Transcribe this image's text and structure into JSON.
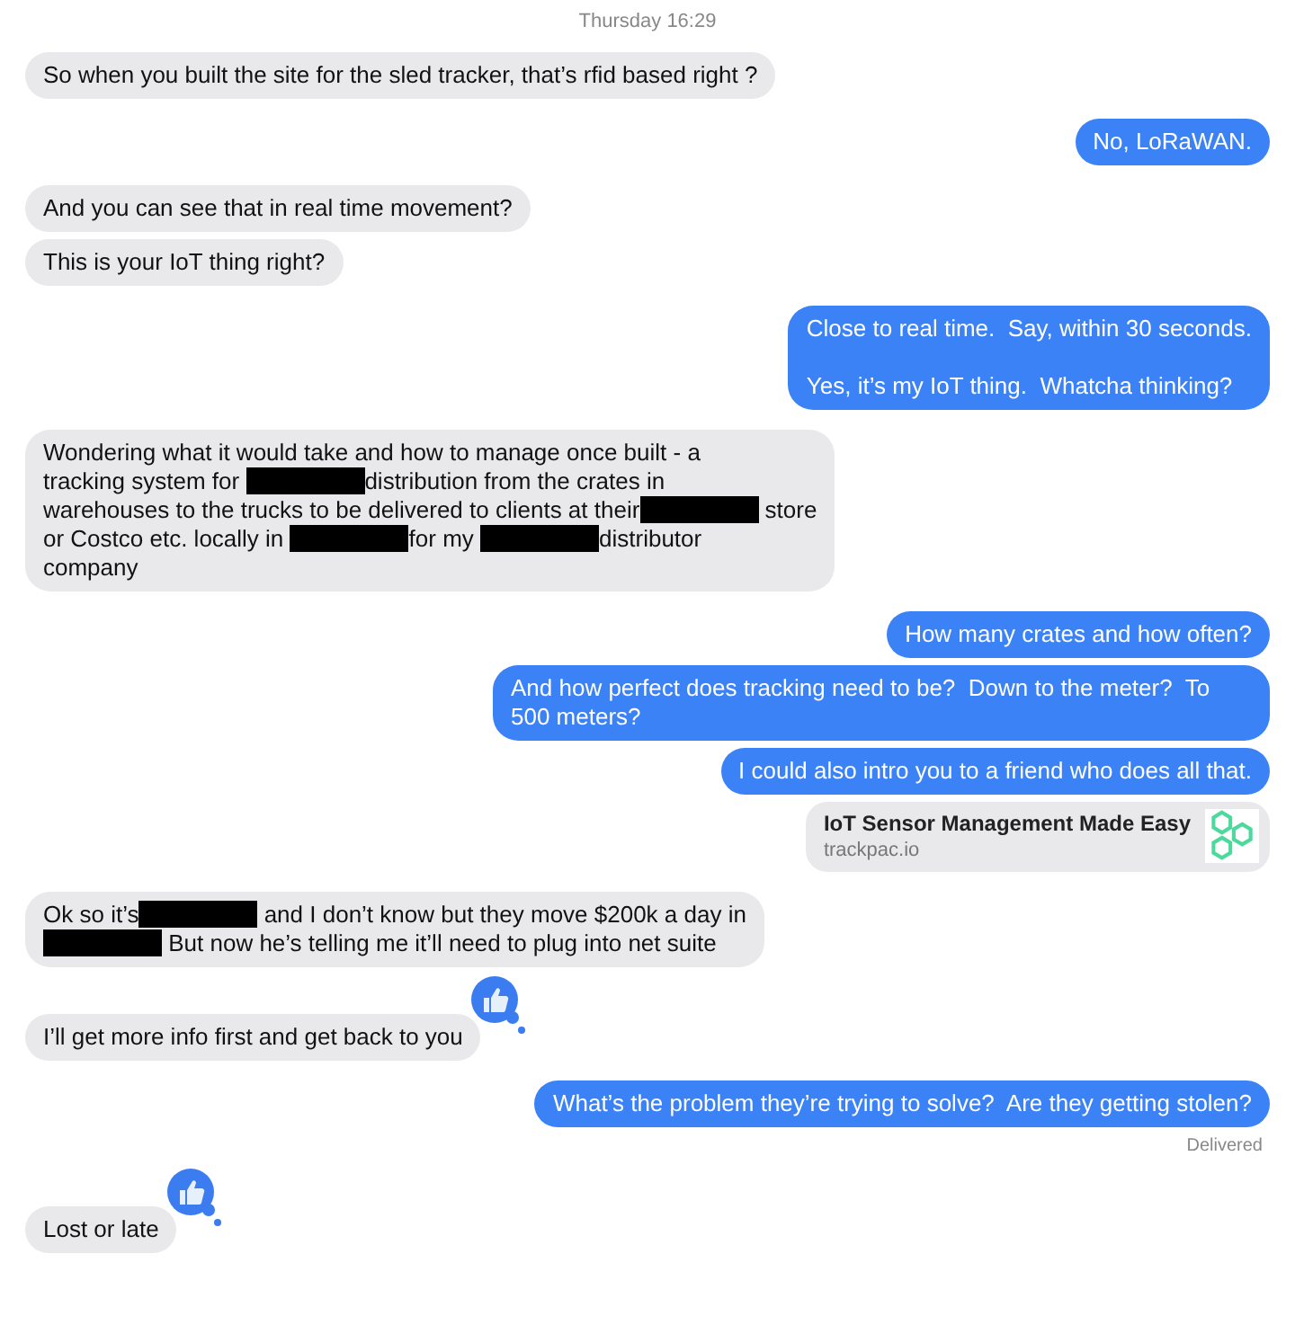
{
  "timestamp": "Thursday 16:29",
  "messages": [
    {
      "kind": "received",
      "text": "So when you built the site for the sled tracker, that’s rfid based right ?"
    },
    {
      "kind": "sent",
      "text": "No, LoRaWAN."
    },
    {
      "kind": "received",
      "text": "And you can see that in real time movement?"
    },
    {
      "kind": "received",
      "text": "This is your IoT thing right?"
    },
    {
      "kind": "sent",
      "text": "Close to real time.  Say, within 30 seconds.\n\nYes, it’s my IoT thing.  Whatcha thinking?"
    },
    {
      "kind": "received",
      "lines": [
        [
          {
            "kind": "text",
            "text": "Wondering what it would take and how to manage once built - a"
          }
        ],
        [
          {
            "kind": "text",
            "text": "tracking system for "
          },
          {
            "kind": "redacted"
          },
          {
            "kind": "text",
            "text": "distribution from the crates in"
          }
        ],
        [
          {
            "kind": "text",
            "text": "warehouses to the trucks to be delivered to clients at their"
          },
          {
            "kind": "redacted"
          },
          {
            "kind": "text",
            "text": " store"
          }
        ],
        [
          {
            "kind": "text",
            "text": "or Costco etc. locally in "
          },
          {
            "kind": "redacted"
          },
          {
            "kind": "text",
            "text": "for my "
          },
          {
            "kind": "redacted"
          },
          {
            "kind": "text",
            "text": "distributor"
          }
        ],
        [
          {
            "kind": "text",
            "text": "company"
          }
        ]
      ]
    },
    {
      "kind": "sent",
      "text": "How many crates and how often?"
    },
    {
      "kind": "sent",
      "text": "And how perfect does tracking need to be?  Down to the meter?  To 500 meters?"
    },
    {
      "kind": "sent",
      "text": "I could also intro you to a friend who does all that."
    },
    {
      "kind": "link",
      "title": "IoT Sensor Management Made Easy",
      "domain": "trackpac.io"
    },
    {
      "kind": "received",
      "lines": [
        [
          {
            "kind": "text",
            "text": "Ok so it’s"
          },
          {
            "kind": "redacted"
          },
          {
            "kind": "text",
            "text": " and I don’t know but they move $200k a day in"
          }
        ],
        [
          {
            "kind": "redacted"
          },
          {
            "kind": "text",
            "text": " But now he’s telling me it’ll need to plug into net suite"
          }
        ]
      ]
    },
    {
      "kind": "received",
      "liked": true,
      "text": "I’ll get more info first and get back to you"
    },
    {
      "kind": "sent",
      "status": "Delivered",
      "text": "What’s the problem they’re trying to solve?  Are they getting stolen?"
    },
    {
      "kind": "received",
      "liked": true,
      "text": "Lost or late"
    }
  ]
}
